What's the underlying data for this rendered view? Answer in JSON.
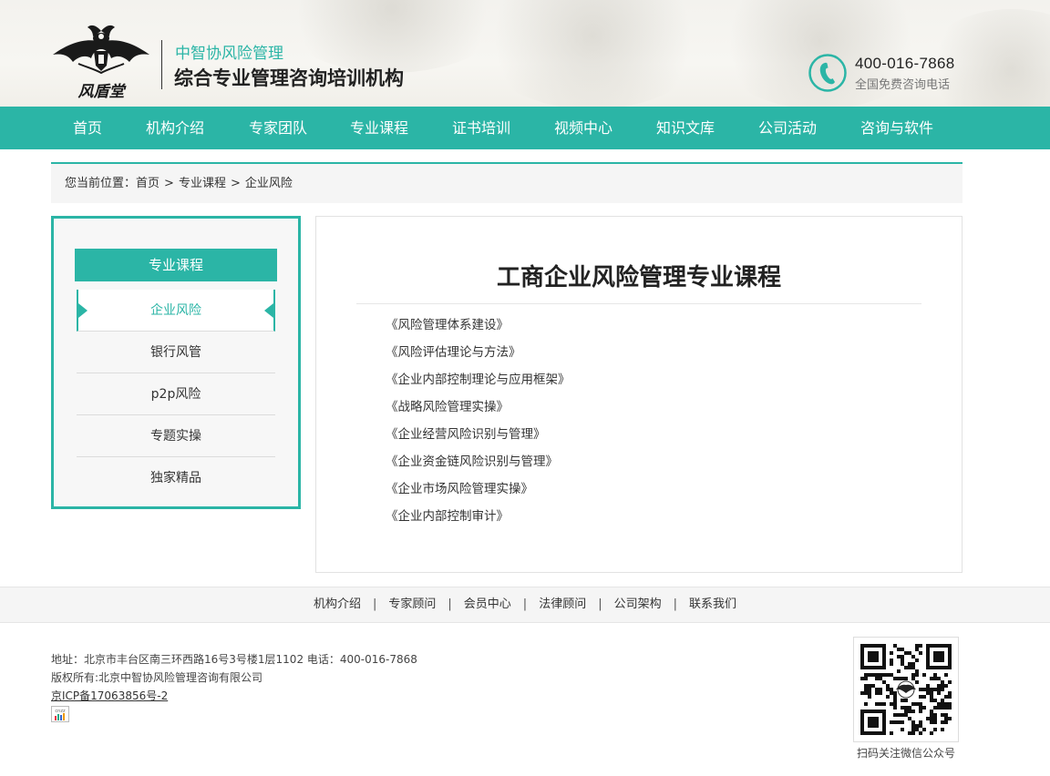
{
  "header": {
    "logo_text": "风盾堂",
    "subtitle": "中智协风险管理",
    "title": "综合专业管理咨询培训机构",
    "phone": "400-016-7868",
    "phone_caption": "全国免费咨询电话"
  },
  "nav": {
    "items": [
      "首页",
      "机构介绍",
      "专家团队",
      "专业课程",
      "证书培训",
      "视频中心",
      "知识文库",
      "公司活动",
      "咨询与软件"
    ]
  },
  "breadcrumb": {
    "prefix": "您当前位置：",
    "items": [
      "首页",
      "专业课程",
      "企业风险"
    ],
    "separator": ">"
  },
  "sidebar": {
    "title": "专业课程",
    "items": [
      "企业风险",
      "银行风管",
      "p2p风险",
      "专题实操",
      "独家精品"
    ],
    "active_index": 0
  },
  "content": {
    "title": "工商企业风险管理专业课程",
    "courses": [
      "《风险管理体系建设》",
      "《风险评估理论与方法》",
      "《企业内部控制理论与应用框架》",
      "《战略风险管理实操》",
      "《企业经营风险识别与管理》",
      "《企业资金链风险识别与管理》",
      "《企业市场风险管理实操》",
      "《企业内部控制审计》"
    ]
  },
  "footer": {
    "links": [
      "机构介绍",
      "专家顾问",
      "会员中心",
      "法律顾问",
      "公司架构",
      "联系我们"
    ],
    "link_separator": "|",
    "address": "地址：北京市丰台区南三环西路16号3号楼1层1102 电话：400-016-7868",
    "copyright": "版权所有:北京中智协风险管理咨询有限公司",
    "icp": "京ICP备17063856号-2",
    "stat_label": "cnzz",
    "qr_caption": "扫码关注微信公众号"
  },
  "colors": {
    "accent": "#2bb5a6",
    "text": "#333333",
    "panel_bg": "#f5f5f5"
  },
  "icons": {
    "phone": "phone-icon",
    "logo": "bat-emblem-icon",
    "qr": "qr-code-icon",
    "stat": "stat-chart-icon"
  }
}
